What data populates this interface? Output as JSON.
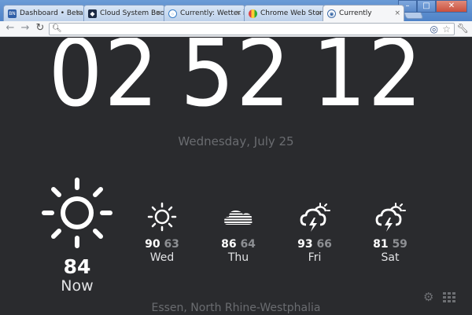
{
  "tabs": [
    {
      "title": "Dashboard • BetaNe",
      "favicon": "BN"
    },
    {
      "title": "Cloud System Booste",
      "favicon": "shield-icon"
    },
    {
      "title": "Currently: Wetter im",
      "favicon": "circle-icon"
    },
    {
      "title": "Chrome Web Store -",
      "favicon": "store-icon"
    },
    {
      "title": "Currently",
      "favicon": "currently-icon",
      "active": true
    }
  ],
  "address_bar": {
    "value": "",
    "placeholder": ""
  },
  "clock": {
    "hours": "02",
    "minutes": "52",
    "seconds": "12"
  },
  "date": "Wednesday, July 25",
  "current": {
    "temp": "84",
    "label": "Now",
    "icon": "sun-icon"
  },
  "forecast": [
    {
      "hi": "90",
      "lo": "63",
      "day": "Wed",
      "icon": "sun-icon"
    },
    {
      "hi": "86",
      "lo": "64",
      "day": "Thu",
      "icon": "fog-icon"
    },
    {
      "hi": "93",
      "lo": "66",
      "day": "Fri",
      "icon": "thunderstorm-icon"
    },
    {
      "hi": "81",
      "lo": "59",
      "day": "Sat",
      "icon": "thunderstorm-icon"
    }
  ],
  "location": "Essen, North Rhine-Westphalia",
  "colors": {
    "background": "#2a2b2e",
    "text": "#ffffff",
    "muted": "#6a6c70",
    "low_temp": "#8d8f93"
  }
}
